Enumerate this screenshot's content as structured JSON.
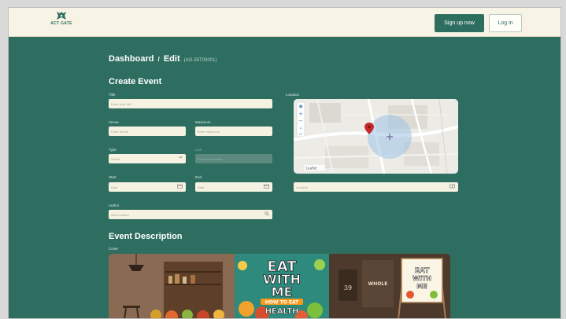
{
  "header": {
    "logo_text": "ACT GATE",
    "signup_label": "Sign up now",
    "login_label": "Log in"
  },
  "breadcrumb": {
    "dashboard": "Dashboard",
    "separator": "/",
    "edit": "Edit",
    "id": "(AG-25T00001)"
  },
  "form": {
    "heading": "Create Event",
    "title_label": "Title",
    "title_placeholder": "Enter your title",
    "venue_label": "Venue",
    "venue_placeholder": "Enter Venue",
    "maximum_label": "Maximum",
    "maximum_placeholder": "Enter maximum",
    "type_label": "Type",
    "type_value": "Select",
    "link_label": "Link",
    "link_placeholder": "Enter link address",
    "start_label": "Start",
    "start_placeholder": "Date",
    "end_label": "End",
    "end_placeholder": "Date",
    "author_label": "Author",
    "author_placeholder": "Add a author",
    "location_label": "Location",
    "location_placeholder": "Location",
    "map_attribution": "Leaflet"
  },
  "description": {
    "heading": "Event Description",
    "cover_label": "Cover",
    "cover_line1": "EAT",
    "cover_line2": "WITH",
    "cover_line3": "ME",
    "cover_sub1": "HOW TO EAT",
    "cover_sub2": "HEALTH",
    "cover_number": "39",
    "cover_whole": "WHOLE"
  },
  "colors": {
    "background": "#2e6e61",
    "topbar": "#f8f4e5",
    "input": "#f6f2e2",
    "accent": "#2e6e61"
  },
  "icons": {
    "calendar": "calendar-icon",
    "search": "search-icon",
    "chevron": "chevron-down-icon",
    "map_pin": "map-pin-icon",
    "location": "location-icon"
  }
}
